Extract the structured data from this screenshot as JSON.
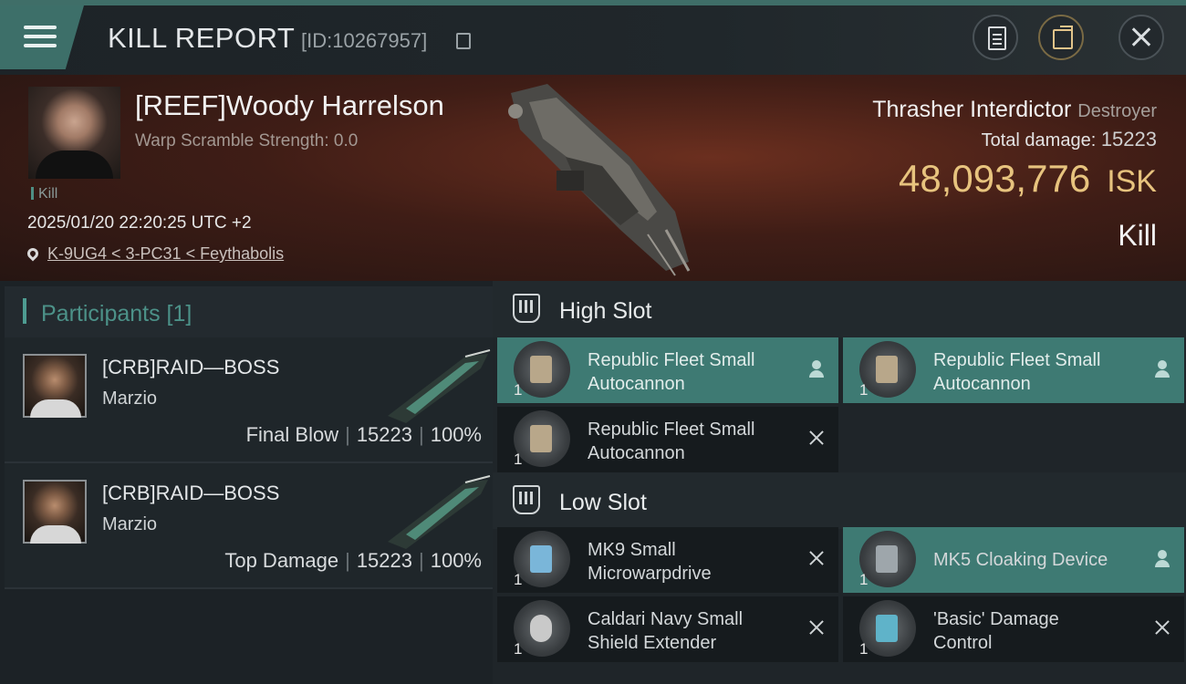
{
  "header": {
    "title": "KILL REPORT",
    "id_text": "[ID:10267957]",
    "icons": [
      "menu-icon",
      "copy-icon",
      "clipboard-icon",
      "share-icon",
      "close-icon"
    ]
  },
  "victim": {
    "name": "[REEF]Woody Harrelson",
    "scramble": "Warp Scramble Strength: 0.0",
    "tag": "Kill",
    "datetime": "2025/01/20 22:20:25 UTC +2",
    "location": "K-9UG4 < 3-PC31 < Feythabolis",
    "ship_name": "Thrasher Interdictor",
    "ship_class": "Destroyer",
    "total_damage_label": "Total damage:",
    "total_damage": "15223",
    "isk_value": "48,093,776",
    "isk_unit": "ISK",
    "result": "Kill"
  },
  "participants": {
    "header": "Participants [1]",
    "rows": [
      {
        "name": "[CRB]RAID—BOSS",
        "corp": "Marzio",
        "role": "Final Blow",
        "damage": "15223",
        "percent": "100%"
      },
      {
        "name": "[CRB]RAID—BOSS",
        "corp": "Marzio",
        "role": "Top Damage",
        "damage": "15223",
        "percent": "100%"
      }
    ]
  },
  "slots": {
    "high": {
      "title": "High Slot",
      "modules": [
        {
          "line1": "Republic Fleet Small",
          "line2": "Autocannon",
          "qty": "1",
          "status": "destroyed-by-player"
        },
        {
          "line1": "Republic Fleet Small",
          "line2": "Autocannon",
          "qty": "1",
          "status": "destroyed-by-player"
        },
        {
          "line1": "Republic Fleet Small",
          "line2": "Autocannon",
          "qty": "1",
          "status": "dropped"
        }
      ]
    },
    "low": {
      "title": "Low Slot",
      "modules": [
        {
          "line1": "MK9 Small",
          "line2": "Microwarpdrive",
          "qty": "1",
          "status": "dropped"
        },
        {
          "line1": "MK5 Cloaking Device",
          "line2": "",
          "qty": "1",
          "status": "destroyed-by-player"
        },
        {
          "line1": "Caldari Navy Small",
          "line2": "Shield Extender",
          "qty": "1",
          "status": "dropped"
        },
        {
          "line1": "'Basic' Damage",
          "line2": "Control",
          "qty": "1",
          "status": "dropped"
        }
      ]
    }
  },
  "colors": {
    "accent": "#3e7a73",
    "isk": "#e7c37e",
    "hero": "#3f1d16"
  }
}
